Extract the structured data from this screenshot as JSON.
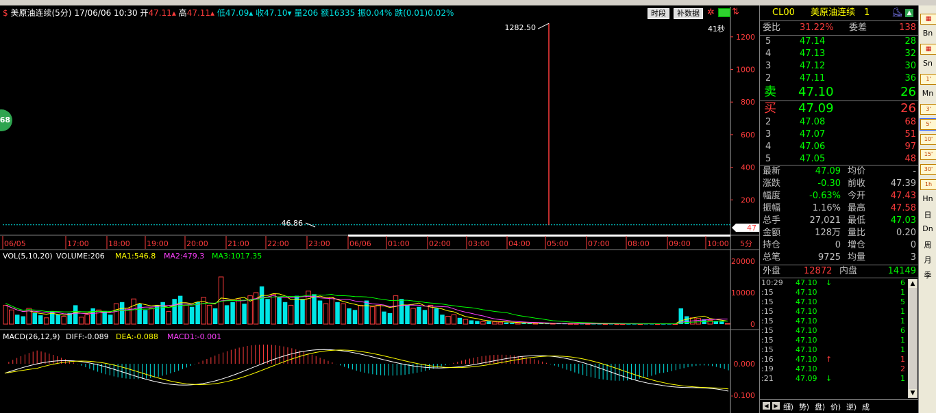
{
  "title_bar": {
    "symbol_icon": "dollar-icon",
    "name": "美原油连续",
    "period": "(5分)",
    "datetime": "17/06/06 10:30",
    "open_label": "开",
    "open_value": "47.11",
    "high_label": "高",
    "high_value": "47.11",
    "low_label": "低",
    "low_value": "47.09",
    "close_label": "收",
    "close_value": "47.10",
    "vol_label": "量",
    "vol_value": "206",
    "amount_label": "额",
    "amount_value": "16335",
    "amp_label": "振",
    "amp_value": "0.04%",
    "chg_label": "跌",
    "chg_value": "(0.01)",
    "chg_pct": "0.02%"
  },
  "buttons": {
    "period_seg": "时段",
    "fill_data": "补数据"
  },
  "left_badge": "68",
  "main_chart": {
    "max_label": "1282.50",
    "min_label": "46.86",
    "countdown": "41秒",
    "y_ticks": [
      "1200",
      "1000",
      "800",
      "600",
      "400",
      "200"
    ],
    "y_tick_values": [
      1200,
      1000,
      800,
      600,
      400,
      200
    ],
    "last_price_tag": "47",
    "period_tag": "5分",
    "time_labels": [
      "06/05",
      "17:00",
      "18:00",
      "19:00",
      "20:00",
      "21:00",
      "22:00",
      "23:00",
      "06/06",
      "01:00",
      "02:00",
      "03:00",
      "04:00",
      "05:00",
      "07:00",
      "08:00",
      "09:00",
      "10:00"
    ]
  },
  "vol_panel": {
    "title": "VOL(5,10,20)",
    "volume_label": "VOLUME:206",
    "ma1": "MA1:546.8",
    "ma2": "MA2:479.3",
    "ma3": "MA3:1017.35",
    "y_ticks": [
      "20000",
      "10000",
      "0"
    ]
  },
  "macd_panel": {
    "title": "MACD(26,12,9)",
    "diff": "DIFF:-0.089",
    "dea": "DEA:-0.088",
    "macd1": "MACD1:-0.001",
    "y_ticks": [
      "0.000",
      "-0.100"
    ]
  },
  "quote": {
    "code": "CL00",
    "name": "美原油连续",
    "num": "1",
    "weibi_label": "委比",
    "weibi_value": "31.22%",
    "weicha_label": "委差",
    "weicha_value": "138",
    "asks": [
      {
        "level": "5",
        "price": "47.14",
        "vol": "28"
      },
      {
        "level": "4",
        "price": "47.13",
        "vol": "32"
      },
      {
        "level": "3",
        "price": "47.12",
        "vol": "30"
      },
      {
        "level": "2",
        "price": "47.11",
        "vol": "36"
      }
    ],
    "sell_label": "卖",
    "sell_price": "47.10",
    "sell_vol": "26",
    "buy_label": "买",
    "buy_price": "47.09",
    "buy_vol": "26",
    "bids": [
      {
        "level": "2",
        "price": "47.08",
        "vol": "68"
      },
      {
        "level": "3",
        "price": "47.07",
        "vol": "51"
      },
      {
        "level": "4",
        "price": "47.06",
        "vol": "97"
      },
      {
        "level": "5",
        "price": "47.05",
        "vol": "48"
      }
    ],
    "stats": [
      {
        "l1": "最新",
        "v1": "47.09",
        "l2": "均价",
        "v2": "-",
        "c1": "#00ff00",
        "c2": "#c0c0c0"
      },
      {
        "l1": "涨跌",
        "v1": "-0.30",
        "l2": "前收",
        "v2": "47.39",
        "c1": "#00ff00",
        "c2": "#c0c0c0"
      },
      {
        "l1": "幅度",
        "v1": "-0.63%",
        "l2": "今开",
        "v2": "47.43",
        "c1": "#00ff00",
        "c2": "#ff3c3c"
      },
      {
        "l1": "振幅",
        "v1": "1.16%",
        "l2": "最高",
        "v2": "47.58",
        "c1": "#c0c0c0",
        "c2": "#ff3c3c"
      },
      {
        "l1": "总手",
        "v1": "27,021",
        "l2": "最低",
        "v2": "47.03",
        "c1": "#c0c0c0",
        "c2": "#00ff00"
      },
      {
        "l1": "金额",
        "v1": "128万",
        "l2": "量比",
        "v2": "0.20",
        "c1": "#c0c0c0",
        "c2": "#c0c0c0"
      },
      {
        "l1": "持仓",
        "v1": "0",
        "l2": "增仓",
        "v2": "0",
        "c1": "#c0c0c0",
        "c2": "#c0c0c0"
      },
      {
        "l1": "总笔",
        "v1": "9725",
        "l2": "均量",
        "v2": "3",
        "c1": "#c0c0c0",
        "c2": "#c0c0c0"
      }
    ],
    "outer_label": "外盘",
    "outer_value": "12872",
    "inner_label": "内盘",
    "inner_value": "14149"
  },
  "ticks": [
    {
      "time": "10:29",
      "price": "47.10",
      "arrow": "↓",
      "vol": "6",
      "acolor": "#00ff00",
      "vcolor": "#00ff00"
    },
    {
      "time": ":15",
      "price": "47.10",
      "arrow": "",
      "vol": "1",
      "acolor": "",
      "vcolor": "#00ff00"
    },
    {
      "time": ":15",
      "price": "47.10",
      "arrow": "",
      "vol": "5",
      "acolor": "",
      "vcolor": "#00ff00"
    },
    {
      "time": ":15",
      "price": "47.10",
      "arrow": "",
      "vol": "1",
      "acolor": "",
      "vcolor": "#00ff00"
    },
    {
      "time": ":15",
      "price": "47.10",
      "arrow": "",
      "vol": "1",
      "acolor": "",
      "vcolor": "#00ff00"
    },
    {
      "time": ":15",
      "price": "47.10",
      "arrow": "",
      "vol": "6",
      "acolor": "",
      "vcolor": "#00ff00"
    },
    {
      "time": ":15",
      "price": "47.10",
      "arrow": "",
      "vol": "1",
      "acolor": "",
      "vcolor": "#00ff00"
    },
    {
      "time": ":15",
      "price": "47.10",
      "arrow": "",
      "vol": "1",
      "acolor": "",
      "vcolor": "#00ff00"
    },
    {
      "time": ":16",
      "price": "47.10",
      "arrow": "↑",
      "vol": "1",
      "acolor": "#ff3c3c",
      "vcolor": "#ff3c3c"
    },
    {
      "time": ":19",
      "price": "47.10",
      "arrow": "",
      "vol": "2",
      "acolor": "",
      "vcolor": "#ff3c3c"
    },
    {
      "time": ":21",
      "price": "47.09",
      "arrow": "↓",
      "vol": "1",
      "acolor": "#00ff00",
      "vcolor": "#00ff00"
    }
  ],
  "panel_tabs": [
    "细",
    "势",
    "盘",
    "价",
    "逆",
    "成"
  ],
  "sidebar": [
    {
      "label": "",
      "icon": "chart-icon"
    },
    {
      "label": "Bn",
      "icon": ""
    },
    {
      "label": "",
      "icon": "line-chart-icon"
    },
    {
      "label": "Sn",
      "icon": ""
    },
    {
      "label": "1'",
      "icon": ""
    },
    {
      "label": "Mn",
      "icon": ""
    },
    {
      "label": "3'",
      "icon": ""
    },
    {
      "label": "5'",
      "icon": ""
    },
    {
      "label": "10'",
      "icon": ""
    },
    {
      "label": "15'",
      "icon": ""
    },
    {
      "label": "30'",
      "icon": ""
    },
    {
      "label": "1h",
      "icon": ""
    },
    {
      "label": "Hn",
      "icon": ""
    },
    {
      "label": "日",
      "icon": ""
    },
    {
      "label": "Dn",
      "icon": ""
    },
    {
      "label": "周",
      "icon": ""
    },
    {
      "label": "月",
      "icon": ""
    },
    {
      "label": "季",
      "icon": ""
    }
  ],
  "chart_data": {
    "type": "candlestick",
    "price_range": [
      0,
      1300
    ],
    "price_series_note_values": [
      46.86,
      47.09,
      47.1,
      47.11,
      1282.5
    ],
    "volume_ylim": [
      0,
      20000
    ],
    "volume_values": [
      6000,
      4500,
      3000,
      2500,
      5000,
      3500,
      2800,
      2000,
      4000,
      3000,
      2500,
      3500,
      6000,
      2200,
      3000,
      5000,
      4500,
      4000,
      3000,
      6500,
      7000,
      5000,
      8000,
      6500,
      4500,
      5000,
      6000,
      7000,
      4000,
      8000,
      9000,
      6000,
      5500,
      7000,
      8500,
      6000,
      5000,
      15000,
      6000,
      7000,
      8000,
      6500,
      9000,
      10000,
      12000,
      8000,
      9500,
      8500,
      7000,
      6000,
      9000,
      8000,
      10500,
      9500,
      7500,
      6500,
      8500,
      7000,
      6500,
      5000,
      4500,
      6000,
      7500,
      5500,
      6000,
      4000,
      3500,
      9000,
      8000,
      6000,
      5000,
      5500,
      4500,
      6000,
      5000,
      3000,
      2500,
      3000,
      2000,
      1500,
      1200,
      1000,
      800,
      900,
      700,
      600,
      500,
      400,
      350,
      300,
      280,
      250,
      220,
      200,
      250,
      200,
      180,
      160,
      150,
      140,
      130,
      120,
      110,
      100,
      120,
      100,
      90,
      80,
      90,
      100,
      120,
      110,
      100,
      80,
      90,
      100,
      5000,
      2500,
      2000,
      1800,
      1500,
      1200,
      1000,
      800,
      206
    ]
  }
}
